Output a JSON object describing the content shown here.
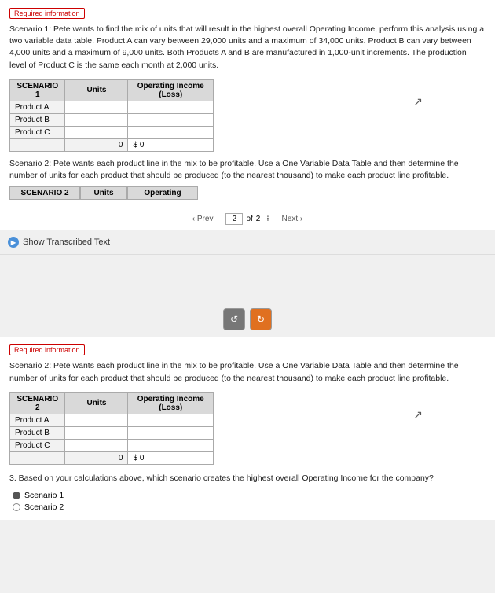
{
  "page1": {
    "required_badge": "Required information",
    "scenario1_text": "Scenario 1: Pete wants to find the mix of units that will result in the highest overall Operating Income, perform this analysis using a two variable data table. Product A can vary between 29,000 units and a maximum of 34,000 units. Product B can vary between 4,000 units and a maximum of 9,000 units. Both Products A and B are manufactured in 1,000-unit increments. The production level of Product C is the same each month at 2,000 units.",
    "table1": {
      "header_col1": "SCENARIO 1",
      "header_col2": "Units",
      "header_col3": "Operating Income (Loss)",
      "rows": [
        {
          "label": "Product A",
          "units": "",
          "income": ""
        },
        {
          "label": "Product B",
          "units": "",
          "income": ""
        },
        {
          "label": "Product C",
          "units": "",
          "income": ""
        }
      ],
      "total_units": "0",
      "total_symbol": "$",
      "total_income": "0"
    },
    "scenario2_text": "Scenario 2: Pete wants each product line in the mix to be profitable. Use a One Variable Data Table and then determine the number of units for each product that should be produced (to the nearest thousand) to make each product line profitable.",
    "partial_header": {
      "col1": "SCENARIO 2",
      "col2": "Units",
      "col3": "Operating"
    }
  },
  "navigation": {
    "prev_label": "Prev",
    "page_current": "2",
    "page_total": "2",
    "next_label": "Next"
  },
  "show_transcribed": {
    "label": "Show Transcribed Text"
  },
  "page2": {
    "required_badge": "Required information",
    "scenario2_text": "Scenario 2: Pete wants each product line in the mix to be profitable. Use a One Variable Data Table and then determine the number of units for each product that should be produced (to the nearest thousand) to make each product line profitable.",
    "table2": {
      "header_col1": "SCENARIO 2",
      "header_col2": "Units",
      "header_col3": "Operating Income (Loss)",
      "rows": [
        {
          "label": "Product A",
          "units": "",
          "income": ""
        },
        {
          "label": "Product B",
          "units": "",
          "income": ""
        },
        {
          "label": "Product C",
          "units": "",
          "income": ""
        }
      ],
      "total_units": "0",
      "total_symbol": "$",
      "total_income": "0"
    },
    "question3_text": "3. Based on your calculations above, which scenario creates the highest overall Operating Income for the company?",
    "radio_options": [
      {
        "label": "Scenario 1",
        "selected": true
      },
      {
        "label": "Scenario 2",
        "selected": false
      }
    ]
  },
  "toolbar": {
    "undo_icon": "↺",
    "redo_icon": "↻"
  }
}
